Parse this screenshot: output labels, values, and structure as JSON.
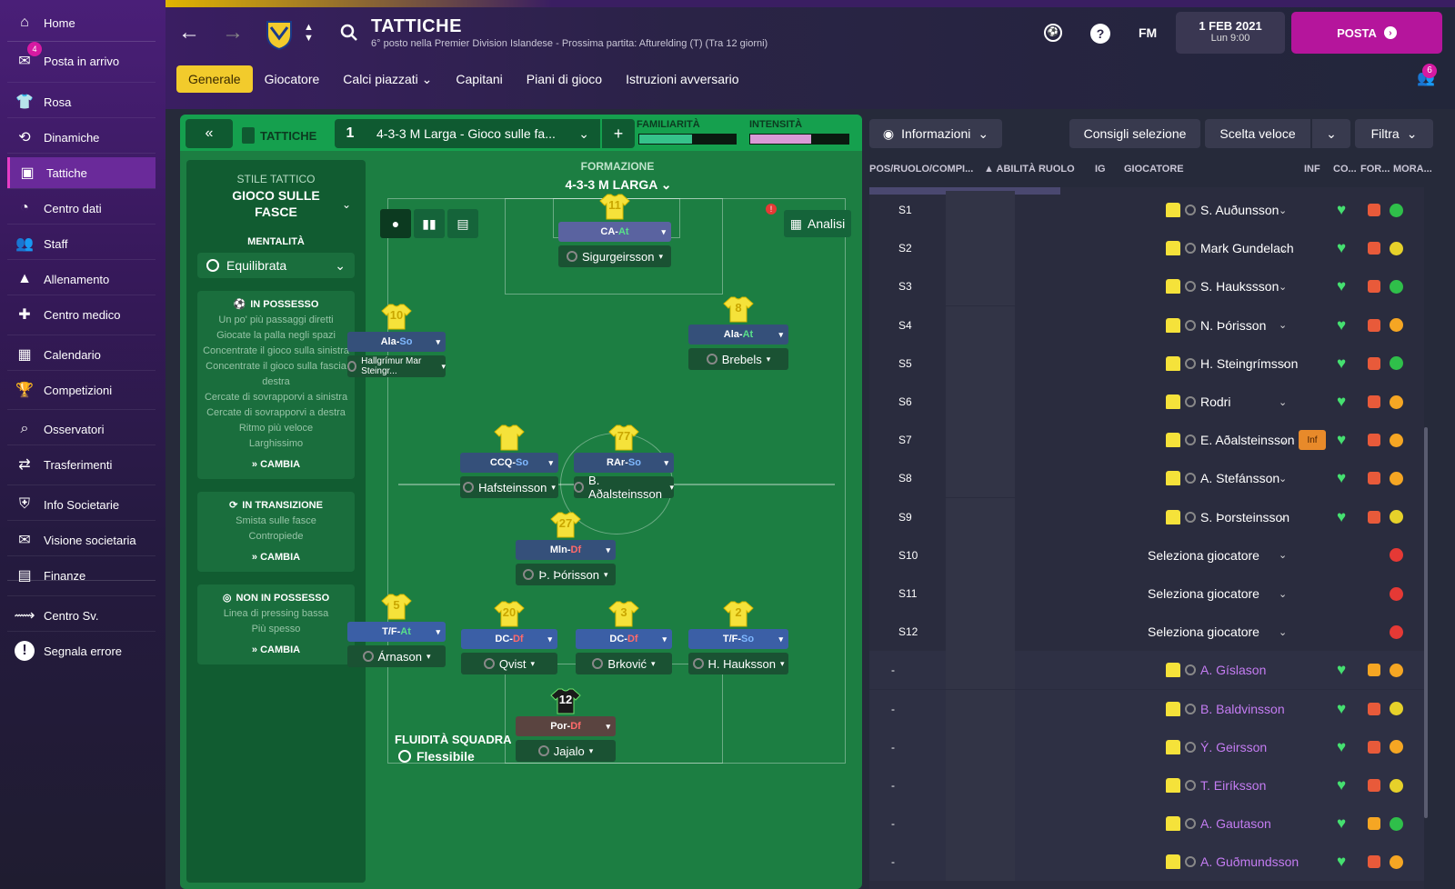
{
  "sidebar": {
    "items": [
      {
        "label": "Home",
        "icon": "home-icon"
      },
      {
        "label": "Posta in arrivo",
        "icon": "inbox-icon",
        "badge": "4"
      },
      {
        "label": "Rosa",
        "icon": "squad-icon"
      },
      {
        "label": "Dinamiche",
        "icon": "dynamics-icon"
      },
      {
        "label": "Tattiche",
        "icon": "tactics-icon",
        "active": true
      },
      {
        "label": "Centro dati",
        "icon": "data-icon"
      },
      {
        "label": "Staff",
        "icon": "staff-icon"
      },
      {
        "label": "Allenamento",
        "icon": "training-icon"
      },
      {
        "label": "Centro medico",
        "icon": "medical-icon"
      },
      {
        "label": "Calendario",
        "icon": "calendar-icon"
      },
      {
        "label": "Competizioni",
        "icon": "trophy-icon"
      },
      {
        "label": "Osservatori",
        "icon": "scouting-icon"
      },
      {
        "label": "Trasferimenti",
        "icon": "transfers-icon"
      },
      {
        "label": "Info Societarie",
        "icon": "club-info-icon"
      },
      {
        "label": "Visione societaria",
        "icon": "vision-icon"
      },
      {
        "label": "Finanze",
        "icon": "finances-icon"
      },
      {
        "label": "Centro Sv.",
        "icon": "dev-centre-icon"
      },
      {
        "label": "Segnala errore",
        "icon": "report-bug-icon"
      }
    ]
  },
  "header": {
    "title": "TATTICHE",
    "subtitle": "6° posto nella Premier Division Islandese - Prossima partita: Afturelding (T) (Tra 12 giorni)",
    "fm_label": "FM",
    "date_line1": "1 FEB 2021",
    "date_line2": "Lun 9:00",
    "posta_label": "POSTA",
    "notif_count": "6"
  },
  "tabs": [
    {
      "label": "Generale",
      "active": true
    },
    {
      "label": "Giocatore"
    },
    {
      "label": "Calci piazzati ⌄"
    },
    {
      "label": "Capitani"
    },
    {
      "label": "Piani di gioco"
    },
    {
      "label": "Istruzioni avversario"
    }
  ],
  "tactic": {
    "label": "TATTICHE",
    "slot": "1",
    "name": "4-3-3 M Larga - Gioco sulle fa...",
    "familiarity_label": "FAMILIARITÀ",
    "familiarity_level": 0.55,
    "intensity_label": "INTENSITÀ",
    "intensity_level": 0.62
  },
  "style": {
    "head": "STILE TATTICO",
    "name": "GIOCO SULLE FASCE",
    "mentality_label": "MENTALITÀ",
    "mentality_value": "Equilibrata",
    "in_possession_title": "IN POSSESSO",
    "in_possession_lines": [
      "Un po' più passaggi diretti",
      "Giocate la palla negli spazi",
      "Concentrate il gioco sulla sinistra",
      "Concentrate il gioco sulla fascia destra",
      "Cercate di sovrapporvi a sinistra",
      "Cercate di sovrapporvi a destra",
      "Ritmo più veloce",
      "Larghissimo"
    ],
    "transition_title": "IN TRANSIZIONE",
    "transition_lines": [
      "Smista sulle fasce",
      "Contropiede"
    ],
    "out_possession_title": "NON IN POSSESSO",
    "out_possession_lines": [
      "Linea di pressing bassa",
      "Più spesso"
    ],
    "change_label": "CAMBIA"
  },
  "formation": {
    "label": "FORMAZIONE",
    "name": "4-3-3 M LARGA",
    "analisi_label": "Analisi",
    "fluid_label": "FLUIDITÀ SQUADRA",
    "fluid_value": "Flessibile",
    "players": [
      {
        "num": "11",
        "role": "CA",
        "duty": "At",
        "dutyc": "green",
        "name": "Sigurgeirsson",
        "kind": "at"
      },
      {
        "num": "10",
        "role": "Ala",
        "duty": "So",
        "dutyc": "blue",
        "name": "Hallgrímur Mar Steingr...",
        "kind": "mid"
      },
      {
        "num": "8",
        "role": "Ala",
        "duty": "At",
        "dutyc": "green",
        "name": "Brebels",
        "kind": "mid"
      },
      {
        "num": "",
        "role": "CCQ",
        "duty": "So",
        "dutyc": "blue",
        "name": "Hafsteinsson",
        "kind": "mid"
      },
      {
        "num": "77",
        "role": "RAr",
        "duty": "So",
        "dutyc": "blue",
        "name": "B. Aðalsteinsson",
        "kind": "mid"
      },
      {
        "num": "27",
        "role": "Mln",
        "duty": "Df",
        "dutyc": "red",
        "name": "Þ. Þórisson",
        "kind": "mid"
      },
      {
        "num": "5",
        "role": "T/F",
        "duty": "At",
        "dutyc": "green",
        "name": "Árnason",
        "kind": "def"
      },
      {
        "num": "20",
        "role": "DC",
        "duty": "Df",
        "dutyc": "red",
        "name": "Qvist",
        "kind": "def"
      },
      {
        "num": "3",
        "role": "DC",
        "duty": "Df",
        "dutyc": "red",
        "name": "Brković",
        "kind": "def"
      },
      {
        "num": "2",
        "role": "T/F",
        "duty": "So",
        "dutyc": "blue",
        "name": "H. Hauksson",
        "kind": "def"
      },
      {
        "num": "12",
        "role": "Por",
        "duty": "Df",
        "dutyc": "red",
        "name": "Jajalo",
        "kind": "gk"
      }
    ]
  },
  "right": {
    "info_label": "Informazioni",
    "advice_label": "Consigli selezione",
    "quick_label": "Scelta veloce",
    "filter_label": "Filtra",
    "columns": [
      "POS/RUOLO/COMPI...",
      "▲ ABILITÀ RUOLO",
      "IG",
      "GIOCATORE",
      "INF",
      "CO...",
      "FOR...",
      "MORA..."
    ],
    "rows": [
      {
        "pos": "S1",
        "name": "S. Auðunsson",
        "status": "green"
      },
      {
        "pos": "S2",
        "name": "Mark Gundelach",
        "status": "yellow"
      },
      {
        "pos": "S3",
        "name": "S. Haukssson",
        "status": "green"
      },
      {
        "pos": "S4",
        "name": "N. Þórisson",
        "status": "orange"
      },
      {
        "pos": "S5",
        "name": "H. Steingrímsson",
        "status": "green"
      },
      {
        "pos": "S6",
        "name": "Rodri",
        "status": "orange"
      },
      {
        "pos": "S7",
        "name": "E. Aðalsteinsson",
        "status": "orange",
        "inf": "Inf"
      },
      {
        "pos": "S8",
        "name": "A. Stefánsson",
        "status": "orange"
      },
      {
        "pos": "S9",
        "name": "S. Þorsteinsson",
        "status": "yellow"
      },
      {
        "pos": "S10",
        "select": "Seleziona giocatore"
      },
      {
        "pos": "S11",
        "select": "Seleziona giocatore"
      },
      {
        "pos": "S12",
        "select": "Seleziona giocatore"
      },
      {
        "pos": "-",
        "name": "A. Gíslason",
        "status": "orange",
        "sub": true
      },
      {
        "pos": "-",
        "name": "B. Baldvinsson",
        "status": "yellow",
        "sub": true
      },
      {
        "pos": "-",
        "name": "Ý. Geirsson",
        "status": "orange",
        "sub": true
      },
      {
        "pos": "-",
        "name": "T. Eiríksson",
        "status": "yellow",
        "sub": true
      },
      {
        "pos": "-",
        "name": "A. Gautason",
        "status": "green",
        "sub": true
      },
      {
        "pos": "-",
        "name": "A. Guðmundsson",
        "status": "orange",
        "sub": true
      }
    ]
  }
}
